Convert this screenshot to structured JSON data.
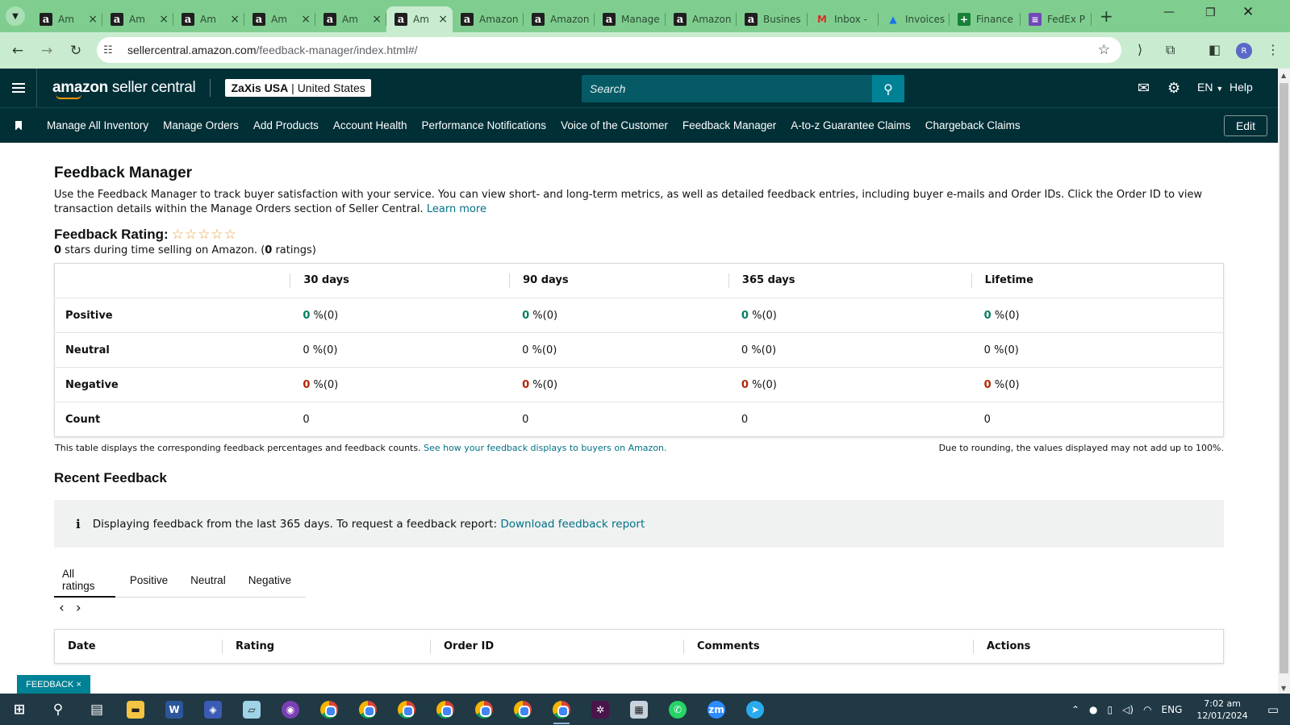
{
  "browser": {
    "tabs": [
      {
        "icon": "amazon-icon",
        "title": "Am",
        "active": false
      },
      {
        "icon": "amazon-icon",
        "title": "Am",
        "active": false
      },
      {
        "icon": "amazon-icon",
        "title": "Am",
        "active": false
      },
      {
        "icon": "amazon-icon",
        "title": "Am",
        "active": false
      },
      {
        "icon": "amazon-icon",
        "title": "Am",
        "active": false
      },
      {
        "icon": "amazon-icon",
        "title": "Am",
        "active": true
      },
      {
        "icon": "amazon-icon",
        "title": "Amazon",
        "active": false
      },
      {
        "icon": "amazon-icon",
        "title": "Amazon",
        "active": false
      },
      {
        "icon": "amazon-icon",
        "title": "Manage",
        "active": false
      },
      {
        "icon": "amazon-icon",
        "title": "Amazon",
        "active": false
      },
      {
        "icon": "amazon-icon",
        "title": "Busines",
        "active": false
      },
      {
        "icon": "gmail-icon",
        "title": "Inbox -",
        "active": false
      },
      {
        "icon": "drive-icon",
        "title": "Invoices",
        "active": false
      },
      {
        "icon": "sheets-icon",
        "title": "Finance",
        "active": false
      },
      {
        "icon": "forms-icon",
        "title": "FedEx P",
        "active": false
      }
    ],
    "url_host": "sellercentral.amazon.com",
    "url_path": "/feedback-manager/index.html#/",
    "profile_initial": "R"
  },
  "header": {
    "logo_bold": "amazon",
    "logo_rest": " seller central",
    "store_name": "ZaXis USA",
    "store_sep": " | ",
    "store_region": "United States",
    "search_placeholder": "Search",
    "language": "EN",
    "help": "Help"
  },
  "nav": {
    "items": [
      "Manage All Inventory",
      "Manage Orders",
      "Add Products",
      "Account Health",
      "Performance Notifications",
      "Voice of the Customer",
      "Feedback Manager",
      "A-to-z Guarantee Claims",
      "Chargeback Claims"
    ],
    "edit_label": "Edit"
  },
  "page": {
    "title": "Feedback Manager",
    "intro": "Use the Feedback Manager to track buyer satisfaction with your service. You can view short- and long-term metrics, as well as detailed feedback entries, including buyer e-mails and Order IDs. Click the Order ID to view transaction details within the Manage Orders section of Seller Central.",
    "learn_more": "Learn more",
    "rating_label": "Feedback Rating:",
    "stars_filled": 0,
    "stars_total": 5,
    "stars_text": "☆☆☆☆☆",
    "rating_stars": "0",
    "rating_sub_mid": " stars during time selling on Amazon. (",
    "rating_count": "0",
    "rating_sub_end": " ratings)"
  },
  "feedback_table": {
    "columns": [
      "30 days",
      "90 days",
      "365 days",
      "Lifetime"
    ],
    "rows": [
      {
        "label": "Positive",
        "tone": "green",
        "values": [
          "0",
          "0",
          "0",
          "0"
        ],
        "suffix": " %(0)"
      },
      {
        "label": "Neutral",
        "tone": "plain",
        "values": [
          "0",
          "0",
          "0",
          "0"
        ],
        "suffix": " %(0)"
      },
      {
        "label": "Negative",
        "tone": "red",
        "values": [
          "0",
          "0",
          "0",
          "0"
        ],
        "suffix": " %(0)"
      },
      {
        "label": "Count",
        "tone": "count",
        "values": [
          "0",
          "0",
          "0",
          "0"
        ],
        "suffix": ""
      }
    ],
    "note": "This table displays the corresponding feedback percentages and feedback counts.",
    "note_link": "See how your feedback displays to buyers on Amazon.",
    "rounding_note": "Due to rounding, the values displayed may not add up to 100%."
  },
  "recent": {
    "title": "Recent Feedback",
    "info_text": "Displaying feedback from the last 365 days. To request a feedback report:",
    "info_link": "Download feedback report",
    "tabs": [
      "All ratings",
      "Positive",
      "Neutral",
      "Negative"
    ],
    "active_tab": "All ratings",
    "pager_prev": "‹",
    "pager_next": "›",
    "columns": [
      "Date",
      "Rating",
      "Order ID",
      "Comments",
      "Actions"
    ]
  },
  "feedback_widget": {
    "label": "FEEDBACK",
    "close": "×"
  },
  "taskbar": {
    "language": "ENG",
    "time": "7:02 am",
    "date": "12/01/2024",
    "apps": [
      "windows-start",
      "search",
      "task-view",
      "file-explorer",
      "word",
      "vpn",
      "notepad",
      "app-badge",
      "chrome",
      "chrome",
      "chrome",
      "chrome",
      "chrome",
      "chrome",
      "chrome",
      "slack",
      "calculator",
      "whatsapp",
      "zoom",
      "telegram"
    ]
  },
  "colors": {
    "header_bg": "#002f36",
    "tab_strip": "#7fce90",
    "link": "#007185",
    "positive": "#067d62",
    "negative": "#b12704",
    "search_btn": "#008296"
  }
}
